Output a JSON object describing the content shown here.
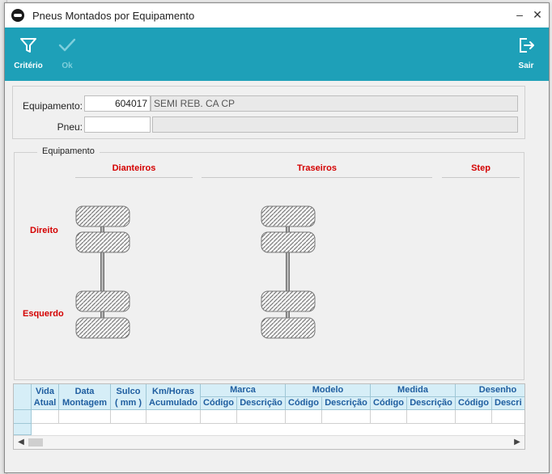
{
  "window": {
    "title": "Pneus Montados por Equipamento"
  },
  "toolbar": {
    "criterio_label": "Critério",
    "ok_label": "Ok",
    "sair_label": "Sair"
  },
  "form": {
    "equipamento_label": "Equipamento:",
    "equipamento_code": "604017",
    "equipamento_desc": "SEMI REB. CA CP",
    "pneu_label": "Pneu:",
    "pneu_code": "",
    "pneu_desc": ""
  },
  "group": {
    "title": "Equipamento",
    "sections": {
      "front": "Dianteiros",
      "rear": "Traseiros",
      "step": "Step"
    },
    "sides": {
      "right": "Direito",
      "left": "Esquerdo"
    }
  },
  "grid": {
    "columns": [
      {
        "line1": "Vida",
        "line2": "Atual"
      },
      {
        "line1": "Data",
        "line2": "Montagem"
      },
      {
        "line1": "Sulco",
        "line2": "( mm )"
      },
      {
        "line1": "Km/Horas",
        "line2": "Acumulado"
      }
    ],
    "groups": [
      {
        "name": "Marca",
        "sub": [
          "Código",
          "Descrição"
        ]
      },
      {
        "name": "Modelo",
        "sub": [
          "Código",
          "Descrição"
        ]
      },
      {
        "name": "Medida",
        "sub": [
          "Código",
          "Descrição"
        ]
      },
      {
        "name": "Desenho",
        "sub": [
          "Código",
          "Descri"
        ]
      }
    ]
  },
  "colors": {
    "accent": "#1ea0b8",
    "section_red": "#d40000",
    "grid_header": "#d6eef7"
  }
}
